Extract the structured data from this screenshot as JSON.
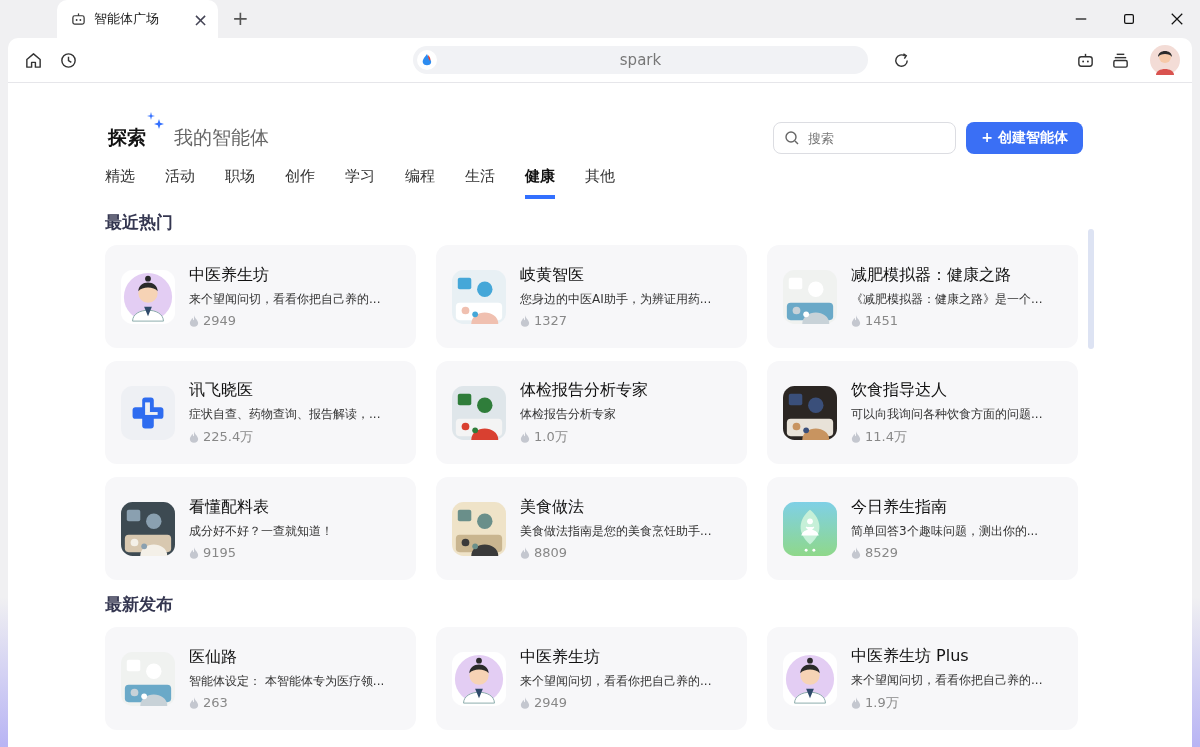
{
  "window": {
    "tab": {
      "title": "智能体广场",
      "close": "×"
    },
    "new_tab": "+"
  },
  "address_bar": {
    "value": "spark"
  },
  "header": {
    "tabs": [
      {
        "label": "探索",
        "selected": true
      },
      {
        "label": "我的智能体",
        "selected": false
      }
    ],
    "search": {
      "placeholder": "搜索"
    },
    "create_button": "+ 创建智能体"
  },
  "categories": [
    {
      "label": "精选",
      "selected": false
    },
    {
      "label": "活动",
      "selected": false
    },
    {
      "label": "职场",
      "selected": false
    },
    {
      "label": "创作",
      "selected": false
    },
    {
      "label": "学习",
      "selected": false
    },
    {
      "label": "编程",
      "selected": false
    },
    {
      "label": "生活",
      "selected": false
    },
    {
      "label": "健康",
      "selected": true
    },
    {
      "label": "其他",
      "selected": false
    }
  ],
  "sections": [
    {
      "title": "最近热门",
      "cards": [
        {
          "kind": "figure",
          "name": "中医养生坊",
          "description": "来个望闻问切，看看你把自己养的...",
          "count": "2949"
        },
        {
          "kind": "picture",
          "name": "岐黄智医",
          "description": "您身边的中医AI助手，为辨证用药...",
          "count": "1327"
        },
        {
          "kind": "picture",
          "name": "减肥模拟器：健康之路",
          "description": "《减肥模拟器：健康之路》是一个...",
          "count": "1451"
        },
        {
          "kind": "logo",
          "name": "讯飞晓医",
          "description": "症状自查、药物查询、报告解读，...",
          "count": "225.4万"
        },
        {
          "kind": "picture",
          "name": "体检报告分析专家",
          "description": "体检报告分析专家",
          "count": "1.0万"
        },
        {
          "kind": "picture",
          "name": "饮食指导达人",
          "description": "可以向我询问各种饮食方面的问题...",
          "count": "11.4万"
        },
        {
          "kind": "picture",
          "name": "看懂配料表",
          "description": "成分好不好？一查就知道！",
          "count": "9195"
        },
        {
          "kind": "picture",
          "name": "美食做法",
          "description": "美食做法指南是您的美食烹饪助手...",
          "count": "8809"
        },
        {
          "kind": "leaf",
          "name": "今日养生指南",
          "description": "简单回答3个趣味问题，测出你的...",
          "count": "8529"
        }
      ]
    },
    {
      "title": "最新发布",
      "cards": [
        {
          "kind": "picture",
          "name": "医仙路",
          "description": "智能体设定： 本智能体专为医疗领...",
          "count": "263"
        },
        {
          "kind": "figure",
          "name": "中医养生坊",
          "description": "来个望闻问切，看看你把自己养的...",
          "count": "2949"
        },
        {
          "kind": "figure",
          "name": "中医养生坊 Plus",
          "description": "来个望闻问切，看看你把自己养的...",
          "count": "1.9万"
        }
      ]
    }
  ]
}
